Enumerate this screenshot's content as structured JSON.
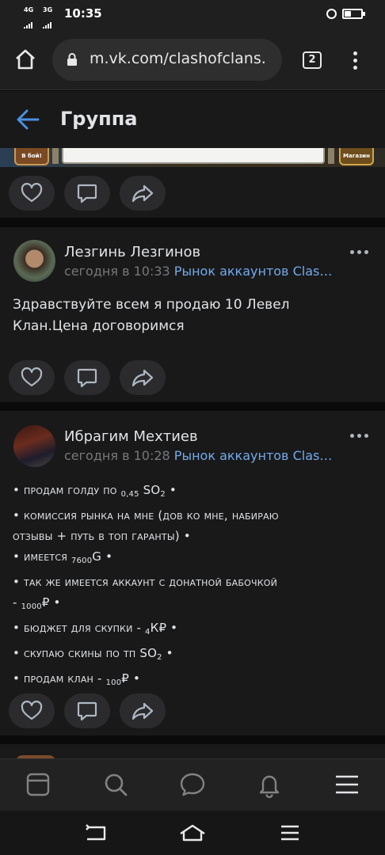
{
  "status_bar": {
    "net1": "4G",
    "net2": "3G",
    "time": "10:35"
  },
  "browser": {
    "url": "m.vk.com/clashofclans.",
    "tab_count": "2"
  },
  "header": {
    "title": "Группа"
  },
  "game_strip": {
    "left_button": "В бой!",
    "right_button": "Магазин"
  },
  "posts": [
    {
      "author": "Лезгинь Лезгинов",
      "time": "сегодня в 10:33",
      "group": "Рынок аккаунтов Clas…",
      "text_lines": [
        "Здравствуйте всем я продаю 10 Левел",
        "Клан.Цена договоримся"
      ]
    },
    {
      "author": "Ибрагим Мехтиев",
      "time": "сегодня в 10:28",
      "group": "Рынок аккаунтов Clas…",
      "lines": [
        {
          "pre": "• продам голду по ",
          "sub": "0,45",
          "post": " SO",
          "sub2": "2",
          "end": " •"
        },
        {
          "pre": "• комиссия рынка на мне (дов ко мне, набираю",
          "sub": "",
          "post": "",
          "sub2": "",
          "end": ""
        },
        {
          "pre": "отзывы + путь в топ гаранты) •",
          "sub": "",
          "post": "",
          "sub2": "",
          "end": ""
        },
        {
          "pre": "• имеется ",
          "sub": "7600",
          "post": "G •",
          "sub2": "",
          "end": ""
        },
        {
          "pre": "• так же имеется аккаунт с донатной бабочкой",
          "sub": "",
          "post": "",
          "sub2": "",
          "end": ""
        },
        {
          "pre": "- ",
          "sub": "1000",
          "post": "₽ •",
          "sub2": "",
          "end": ""
        },
        {
          "pre": "• бюджет для скупки - ",
          "sub": "4",
          "post": "К₽ •",
          "sub2": "",
          "end": ""
        },
        {
          "pre": "• скупаю скины по тп SO",
          "sub": "2",
          "post": " •",
          "sub2": "",
          "end": ""
        },
        {
          "pre": "• продам клан - ",
          "sub": "100",
          "post": "₽ •",
          "sub2": "",
          "end": ""
        }
      ]
    }
  ],
  "icons": {
    "like": "heart-icon",
    "comment": "comment-icon",
    "share": "share-icon"
  },
  "colors": {
    "background": "#0a0a0a",
    "card": "#19191a",
    "link": "#71aaeb",
    "accent": "#4a90e2"
  }
}
